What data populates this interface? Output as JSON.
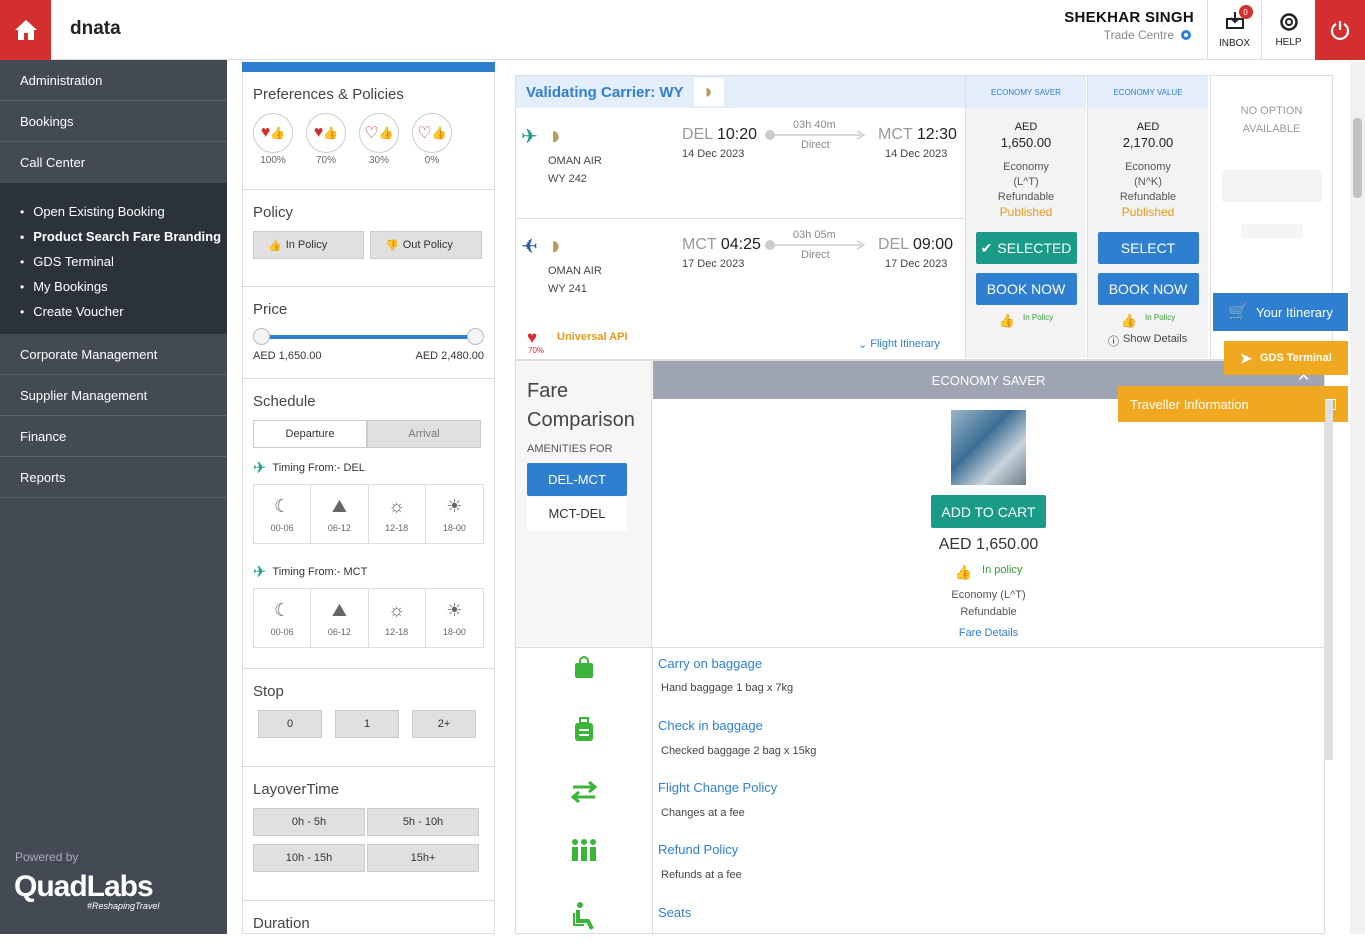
{
  "header": {
    "brand": "dnata",
    "user_name": "SHEKHAR SINGH",
    "user_sub": "Trade Centre",
    "inbox_label": "INBOX",
    "inbox_count": "0",
    "help_label": "HELP"
  },
  "sidebar": {
    "items_top": [
      "Administration",
      "Bookings",
      "Call Center"
    ],
    "subnav": [
      "Open Existing Booking",
      "Product Search Fare Branding",
      "GDS Terminal",
      "My Bookings",
      "Create Voucher"
    ],
    "items_bottom": [
      "Corporate Management",
      "Supplier Management",
      "Finance",
      "Reports"
    ],
    "powered_by": "Powered by",
    "logo": "QuadLabs",
    "tagline": "#ReshapingTravel"
  },
  "filters": {
    "pref_title": "Preferences & Policies",
    "hearts": [
      "100%",
      "70%",
      "30%",
      "0%"
    ],
    "policy_title": "Policy",
    "in_policy": "In Policy",
    "out_policy": "Out Policy",
    "price_title": "Price",
    "price_min": "AED 1,650.00",
    "price_max": "AED 2,480.00",
    "schedule_title": "Schedule",
    "departure": "Departure",
    "arrival": "Arrival",
    "timing_from_1": "Timing From:- DEL",
    "timing_from_2": "Timing From:- MCT",
    "slots": [
      "00-06",
      "06-12",
      "12-18",
      "18-00"
    ],
    "stop_title": "Stop",
    "stops": [
      "0",
      "1",
      "2+"
    ],
    "layover_title": "LayoverTime",
    "layovers": [
      "0h - 5h",
      "5h - 10h",
      "10h - 15h",
      "15h+"
    ],
    "duration_title": "Duration"
  },
  "result": {
    "validating": "Validating Carrier: WY",
    "outbound": {
      "airline": "OMAN AIR",
      "flight": "WY  242",
      "from_code": "DEL",
      "from_time": "10:20",
      "from_date": "14 Dec 2023",
      "duration": "03h 40m",
      "stops": "Direct",
      "to_code": "MCT",
      "to_time": "12:30",
      "to_date": "14 Dec 2023"
    },
    "inbound": {
      "airline": "OMAN AIR",
      "flight": "WY  241",
      "from_code": "MCT",
      "from_time": "04:25",
      "from_date": "17 Dec 2023",
      "duration": "03h 05m",
      "stops": "Direct",
      "to_code": "DEL",
      "to_time": "09:00",
      "to_date": "17 Dec 2023"
    },
    "pref_percent": "70%",
    "source": "Universal API",
    "flight_itinerary": "Flight Itinerary",
    "show_details": "Show Details",
    "fares": [
      {
        "name": "ECONOMY SAVER",
        "currency": "AED",
        "amount": "1,650.00",
        "cabin": "Economy",
        "class": "(L^T)",
        "refund": "Refundable",
        "status": "Published",
        "select": "SELECTED",
        "book": "BOOK NOW",
        "policy": "In Policy"
      },
      {
        "name": "ECONOMY VALUE",
        "currency": "AED",
        "amount": "2,170.00",
        "cabin": "Economy",
        "class": "(N^K)",
        "refund": "Refundable",
        "status": "Published",
        "select": "SELECT",
        "book": "BOOK NOW",
        "policy": "In Policy"
      }
    ],
    "no_option": "NO OPTION AVAILABLE"
  },
  "compare": {
    "title_line1": "Fare",
    "title_line2": "Comparison",
    "amenities_for": "AMENITIES FOR",
    "route_active": "DEL-MCT",
    "route_other": "MCT-DEL",
    "fare_name": "ECONOMY SAVER",
    "add_to_cart": "ADD TO CART",
    "price": "AED 1,650.00",
    "policy": "In policy",
    "class_line": "Economy (L^T)",
    "refund": "Refundable",
    "fare_details": "Fare Details",
    "amenities": [
      {
        "title": "Carry on baggage",
        "value": "Hand baggage 1 bag x 7kg"
      },
      {
        "title": "Check in baggage",
        "value": "Checked baggage 2 bag x 15kg"
      },
      {
        "title": "Flight Change Policy",
        "value": "Changes at a fee"
      },
      {
        "title": "Refund Policy",
        "value": "Refunds at a fee"
      },
      {
        "title": "Seats",
        "value": ""
      }
    ]
  },
  "floating": {
    "your_itinerary": "Your Itinerary",
    "gds_terminal": "GDS Terminal",
    "traveller_info": "Traveller Information"
  },
  "colors": {
    "brand_red": "#d32f2f",
    "primary_blue": "#2f7fd1",
    "teal": "#1a9b87",
    "orange": "#f0a820",
    "sidebar": "#434a54"
  }
}
